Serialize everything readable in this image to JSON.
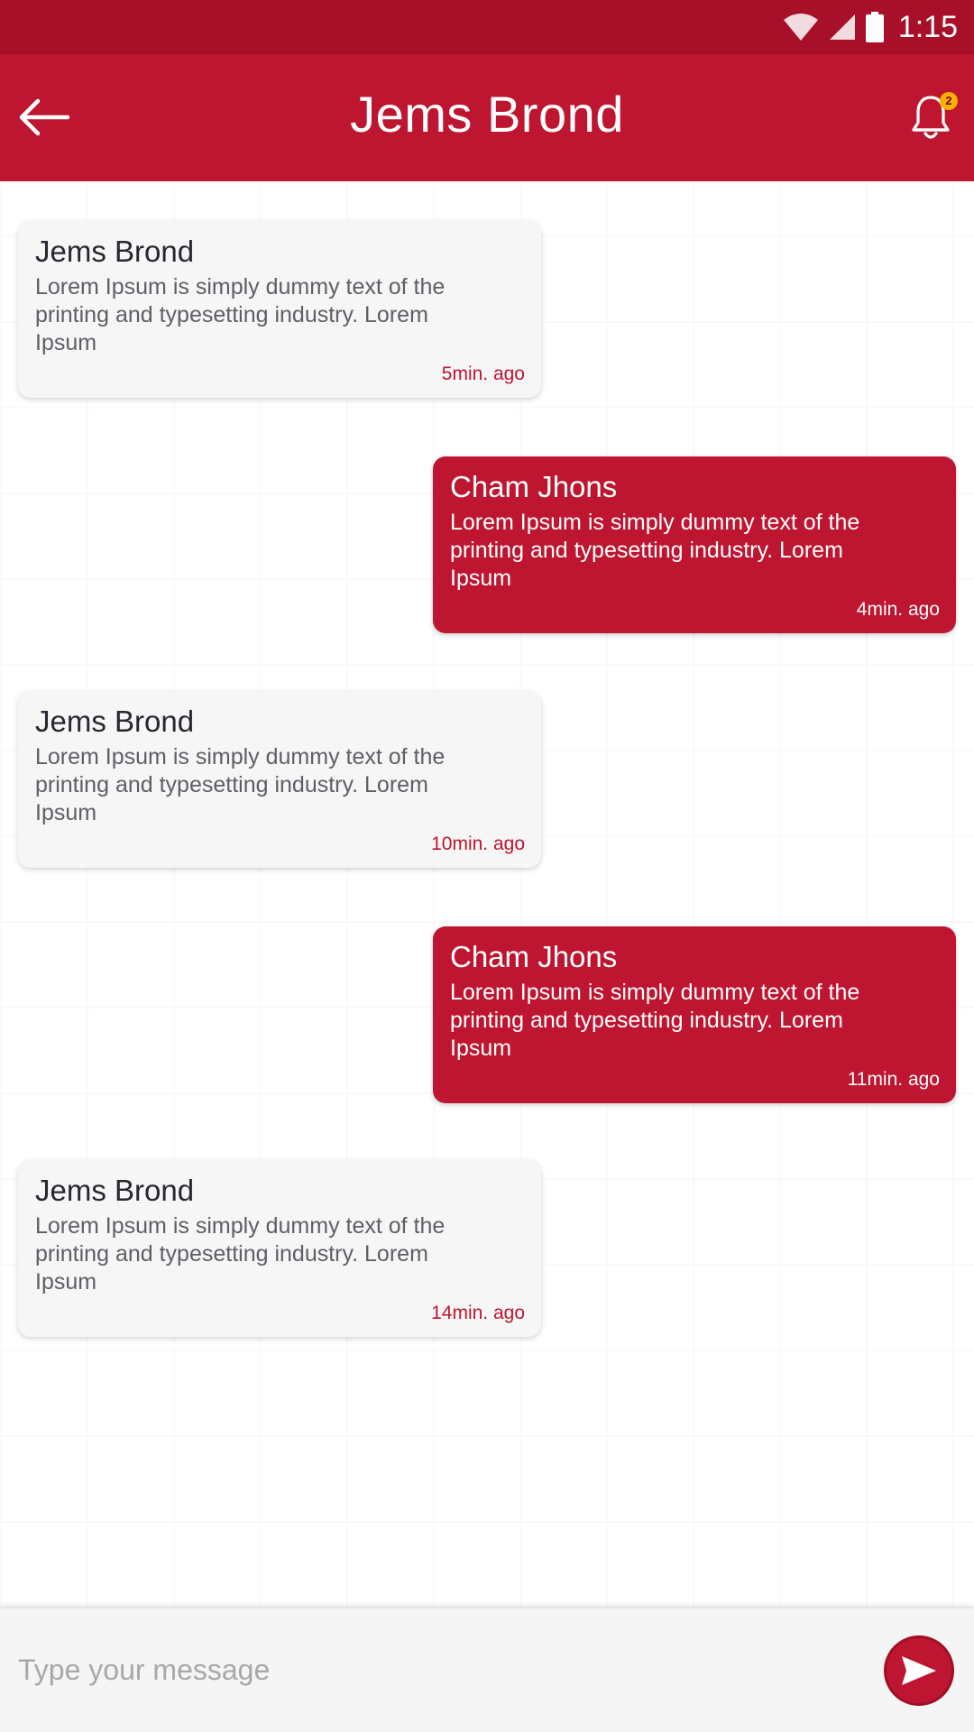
{
  "status_bar": {
    "time": "1:15",
    "icons": [
      "wifi-icon",
      "signal-icon",
      "battery-icon"
    ]
  },
  "header": {
    "title": "Jems Brond",
    "back_icon": "arrow-left-icon",
    "notification_icon": "bell-icon",
    "notification_count": "2"
  },
  "messages": [
    {
      "direction": "received",
      "sender": "Jems Brond",
      "text": "Lorem Ipsum is simply dummy text of the printing and typesetting industry. Lorem Ipsum",
      "time": "5min. ago"
    },
    {
      "direction": "sent",
      "sender": "Cham Jhons",
      "text": "Lorem Ipsum is simply dummy text of the printing and typesetting industry. Lorem Ipsum",
      "time": "4min. ago"
    },
    {
      "direction": "received",
      "sender": "Jems Brond",
      "text": "Lorem Ipsum is simply dummy text of the printing and typesetting industry. Lorem Ipsum",
      "time": "10min. ago"
    },
    {
      "direction": "sent",
      "sender": "Cham Jhons",
      "text": "Lorem Ipsum is simply dummy text of the printing and typesetting industry. Lorem Ipsum",
      "time": "11min. ago"
    },
    {
      "direction": "received",
      "sender": "Jems Brond",
      "text": "Lorem Ipsum is simply dummy text of the printing and typesetting industry. Lorem Ipsum",
      "time": "14min. ago"
    }
  ],
  "composer": {
    "placeholder": "Type your message",
    "send_icon": "send-icon"
  },
  "colors": {
    "primary": "#be1530",
    "status_bar": "#a80f28",
    "bubble_received": "#f6f6f6",
    "badge": "#f5b300"
  }
}
